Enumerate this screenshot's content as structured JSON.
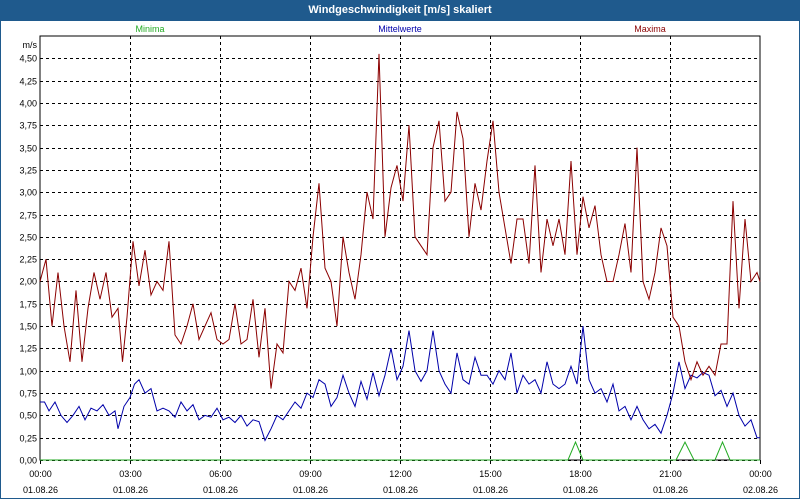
{
  "window": {
    "title": "Windgeschwindigkeit [m/s] skaliert"
  },
  "chart_data": {
    "type": "line",
    "title": "Windgeschwindigkeit [m/s] skaliert",
    "ylabel": "m/s",
    "ylim": [
      0,
      4.75
    ],
    "yticks": [
      "0,00",
      "0,25",
      "0,50",
      "0,75",
      "1,00",
      "1,25",
      "1,50",
      "1,75",
      "2,00",
      "2,25",
      "2,50",
      "2,75",
      "3,00",
      "3,25",
      "3,50",
      "3,75",
      "4,00",
      "4,25",
      "4,50"
    ],
    "xlim": [
      0,
      24
    ],
    "xticks": [
      {
        "time": "00:00",
        "date": "01.08.26"
      },
      {
        "time": "03:00",
        "date": "01.08.26"
      },
      {
        "time": "06:00",
        "date": "01.08.26"
      },
      {
        "time": "09:00",
        "date": "01.08.26"
      },
      {
        "time": "12:00",
        "date": "01.08.26"
      },
      {
        "time": "15:00",
        "date": "01.08.26"
      },
      {
        "time": "18:00",
        "date": "01.08.26"
      },
      {
        "time": "21:00",
        "date": "01.08.26"
      },
      {
        "time": "00:00",
        "date": "02.08.26"
      }
    ],
    "grid": true,
    "series": [
      {
        "name": "Minima",
        "color": "#22aa22",
        "points": [
          [
            0,
            0
          ],
          [
            17.6,
            0
          ],
          [
            17.85,
            0.2
          ],
          [
            18.1,
            0
          ],
          [
            21.2,
            0
          ],
          [
            21.5,
            0.2
          ],
          [
            21.8,
            0
          ],
          [
            22.5,
            0
          ],
          [
            22.75,
            0.2
          ],
          [
            23,
            0
          ],
          [
            24,
            0
          ]
        ]
      },
      {
        "name": "Mittelwerte",
        "color": "#0000aa",
        "points": [
          [
            0,
            0.65
          ],
          [
            0.15,
            0.65
          ],
          [
            0.3,
            0.55
          ],
          [
            0.5,
            0.65
          ],
          [
            0.7,
            0.5
          ],
          [
            0.9,
            0.42
          ],
          [
            1.1,
            0.5
          ],
          [
            1.3,
            0.6
          ],
          [
            1.5,
            0.45
          ],
          [
            1.7,
            0.58
          ],
          [
            1.9,
            0.55
          ],
          [
            2.1,
            0.62
          ],
          [
            2.3,
            0.5
          ],
          [
            2.5,
            0.55
          ],
          [
            2.6,
            0.35
          ],
          [
            2.8,
            0.6
          ],
          [
            3.0,
            0.7
          ],
          [
            3.15,
            0.85
          ],
          [
            3.3,
            0.9
          ],
          [
            3.5,
            0.75
          ],
          [
            3.7,
            0.8
          ],
          [
            3.9,
            0.55
          ],
          [
            4.1,
            0.58
          ],
          [
            4.3,
            0.55
          ],
          [
            4.5,
            0.48
          ],
          [
            4.7,
            0.65
          ],
          [
            4.9,
            0.55
          ],
          [
            5.1,
            0.62
          ],
          [
            5.3,
            0.45
          ],
          [
            5.5,
            0.5
          ],
          [
            5.7,
            0.48
          ],
          [
            5.9,
            0.58
          ],
          [
            6.1,
            0.45
          ],
          [
            6.3,
            0.48
          ],
          [
            6.5,
            0.42
          ],
          [
            6.7,
            0.5
          ],
          [
            6.9,
            0.38
          ],
          [
            7.1,
            0.45
          ],
          [
            7.3,
            0.43
          ],
          [
            7.5,
            0.22
          ],
          [
            7.7,
            0.35
          ],
          [
            7.9,
            0.5
          ],
          [
            8.1,
            0.45
          ],
          [
            8.3,
            0.55
          ],
          [
            8.5,
            0.65
          ],
          [
            8.7,
            0.58
          ],
          [
            8.9,
            0.75
          ],
          [
            9.1,
            0.7
          ],
          [
            9.3,
            0.9
          ],
          [
            9.5,
            0.85
          ],
          [
            9.7,
            0.6
          ],
          [
            9.9,
            0.7
          ],
          [
            10.1,
            0.95
          ],
          [
            10.3,
            0.75
          ],
          [
            10.5,
            0.6
          ],
          [
            10.7,
            0.88
          ],
          [
            10.9,
            0.68
          ],
          [
            11.1,
            0.98
          ],
          [
            11.3,
            0.72
          ],
          [
            11.5,
            0.95
          ],
          [
            11.7,
            1.25
          ],
          [
            11.9,
            0.9
          ],
          [
            12.1,
            1.05
          ],
          [
            12.3,
            1.45
          ],
          [
            12.5,
            1.0
          ],
          [
            12.7,
            0.88
          ],
          [
            12.9,
            1.0
          ],
          [
            13.1,
            1.45
          ],
          [
            13.3,
            1.0
          ],
          [
            13.5,
            0.85
          ],
          [
            13.7,
            0.75
          ],
          [
            13.9,
            1.2
          ],
          [
            14.1,
            0.9
          ],
          [
            14.3,
            0.85
          ],
          [
            14.5,
            1.15
          ],
          [
            14.7,
            0.95
          ],
          [
            14.9,
            0.95
          ],
          [
            15.1,
            0.85
          ],
          [
            15.3,
            1.0
          ],
          [
            15.5,
            0.9
          ],
          [
            15.7,
            1.2
          ],
          [
            15.9,
            0.75
          ],
          [
            16.1,
            0.95
          ],
          [
            16.3,
            0.85
          ],
          [
            16.5,
            0.9
          ],
          [
            16.7,
            0.75
          ],
          [
            16.9,
            1.1
          ],
          [
            17.1,
            0.85
          ],
          [
            17.3,
            0.8
          ],
          [
            17.5,
            0.85
          ],
          [
            17.7,
            1.05
          ],
          [
            17.9,
            0.85
          ],
          [
            18.1,
            1.5
          ],
          [
            18.3,
            0.9
          ],
          [
            18.5,
            0.75
          ],
          [
            18.7,
            0.8
          ],
          [
            18.9,
            0.65
          ],
          [
            19.1,
            0.85
          ],
          [
            19.3,
            0.55
          ],
          [
            19.5,
            0.6
          ],
          [
            19.7,
            0.45
          ],
          [
            19.9,
            0.6
          ],
          [
            20.1,
            0.45
          ],
          [
            20.3,
            0.35
          ],
          [
            20.5,
            0.4
          ],
          [
            20.7,
            0.3
          ],
          [
            20.9,
            0.5
          ],
          [
            21.1,
            0.75
          ],
          [
            21.3,
            1.1
          ],
          [
            21.5,
            0.8
          ],
          [
            21.7,
            0.95
          ],
          [
            21.9,
            0.92
          ],
          [
            22.1,
            0.98
          ],
          [
            22.3,
            0.95
          ],
          [
            22.5,
            0.72
          ],
          [
            22.7,
            0.78
          ],
          [
            22.9,
            0.6
          ],
          [
            23.1,
            0.75
          ],
          [
            23.3,
            0.5
          ],
          [
            23.5,
            0.38
          ],
          [
            23.7,
            0.45
          ],
          [
            23.9,
            0.25
          ],
          [
            24,
            0.25
          ]
        ]
      },
      {
        "name": "Maxima",
        "color": "#8b0000",
        "points": [
          [
            0,
            2.0
          ],
          [
            0.2,
            2.25
          ],
          [
            0.4,
            1.5
          ],
          [
            0.6,
            2.1
          ],
          [
            0.8,
            1.5
          ],
          [
            1.0,
            1.1
          ],
          [
            1.2,
            1.9
          ],
          [
            1.4,
            1.1
          ],
          [
            1.6,
            1.7
          ],
          [
            1.8,
            2.1
          ],
          [
            2.0,
            1.8
          ],
          [
            2.2,
            2.1
          ],
          [
            2.4,
            1.6
          ],
          [
            2.6,
            1.7
          ],
          [
            2.75,
            1.1
          ],
          [
            2.9,
            1.6
          ],
          [
            3.1,
            2.45
          ],
          [
            3.3,
            1.95
          ],
          [
            3.5,
            2.35
          ],
          [
            3.7,
            1.85
          ],
          [
            3.9,
            2.0
          ],
          [
            4.1,
            1.9
          ],
          [
            4.3,
            2.45
          ],
          [
            4.5,
            1.4
          ],
          [
            4.7,
            1.3
          ],
          [
            4.9,
            1.5
          ],
          [
            5.1,
            1.75
          ],
          [
            5.3,
            1.35
          ],
          [
            5.5,
            1.5
          ],
          [
            5.7,
            1.65
          ],
          [
            5.9,
            1.35
          ],
          [
            6.1,
            1.3
          ],
          [
            6.3,
            1.35
          ],
          [
            6.5,
            1.75
          ],
          [
            6.7,
            1.3
          ],
          [
            6.9,
            1.35
          ],
          [
            7.1,
            1.8
          ],
          [
            7.3,
            1.15
          ],
          [
            7.5,
            1.7
          ],
          [
            7.7,
            0.8
          ],
          [
            7.9,
            1.3
          ],
          [
            8.1,
            1.2
          ],
          [
            8.3,
            2.0
          ],
          [
            8.5,
            1.9
          ],
          [
            8.7,
            2.15
          ],
          [
            8.9,
            1.7
          ],
          [
            9.1,
            2.5
          ],
          [
            9.3,
            3.1
          ],
          [
            9.5,
            2.15
          ],
          [
            9.7,
            2.0
          ],
          [
            9.9,
            1.5
          ],
          [
            10.1,
            2.5
          ],
          [
            10.3,
            2.1
          ],
          [
            10.5,
            1.8
          ],
          [
            10.7,
            2.3
          ],
          [
            10.9,
            3.0
          ],
          [
            11.1,
            2.7
          ],
          [
            11.3,
            4.55
          ],
          [
            11.5,
            2.5
          ],
          [
            11.7,
            3.05
          ],
          [
            11.9,
            3.3
          ],
          [
            12.1,
            2.9
          ],
          [
            12.3,
            3.75
          ],
          [
            12.5,
            2.5
          ],
          [
            12.7,
            2.4
          ],
          [
            12.9,
            2.3
          ],
          [
            13.1,
            3.5
          ],
          [
            13.3,
            3.8
          ],
          [
            13.5,
            2.9
          ],
          [
            13.7,
            3.0
          ],
          [
            13.9,
            3.9
          ],
          [
            14.1,
            3.6
          ],
          [
            14.3,
            2.5
          ],
          [
            14.5,
            3.1
          ],
          [
            14.7,
            2.8
          ],
          [
            14.9,
            3.35
          ],
          [
            15.1,
            3.8
          ],
          [
            15.3,
            3.0
          ],
          [
            15.5,
            2.6
          ],
          [
            15.7,
            2.2
          ],
          [
            15.9,
            2.7
          ],
          [
            16.1,
            2.7
          ],
          [
            16.3,
            2.2
          ],
          [
            16.5,
            3.3
          ],
          [
            16.7,
            2.1
          ],
          [
            16.9,
            2.7
          ],
          [
            17.1,
            2.4
          ],
          [
            17.3,
            2.7
          ],
          [
            17.5,
            2.3
          ],
          [
            17.7,
            3.35
          ],
          [
            17.9,
            2.3
          ],
          [
            18.1,
            2.95
          ],
          [
            18.3,
            2.6
          ],
          [
            18.5,
            2.85
          ],
          [
            18.7,
            2.3
          ],
          [
            18.9,
            2.0
          ],
          [
            19.1,
            2.0
          ],
          [
            19.3,
            2.3
          ],
          [
            19.5,
            2.65
          ],
          [
            19.7,
            2.1
          ],
          [
            19.9,
            3.5
          ],
          [
            20.1,
            2.0
          ],
          [
            20.3,
            1.8
          ],
          [
            20.5,
            2.1
          ],
          [
            20.7,
            2.6
          ],
          [
            20.9,
            2.4
          ],
          [
            21.1,
            1.6
          ],
          [
            21.3,
            1.5
          ],
          [
            21.5,
            1.1
          ],
          [
            21.7,
            0.9
          ],
          [
            21.9,
            1.1
          ],
          [
            22.1,
            0.95
          ],
          [
            22.3,
            1.05
          ],
          [
            22.5,
            0.95
          ],
          [
            22.7,
            1.3
          ],
          [
            22.9,
            1.3
          ],
          [
            23.1,
            2.9
          ],
          [
            23.3,
            1.7
          ],
          [
            23.5,
            2.7
          ],
          [
            23.7,
            2.0
          ],
          [
            23.9,
            2.1
          ],
          [
            24,
            2.0
          ]
        ]
      }
    ]
  }
}
